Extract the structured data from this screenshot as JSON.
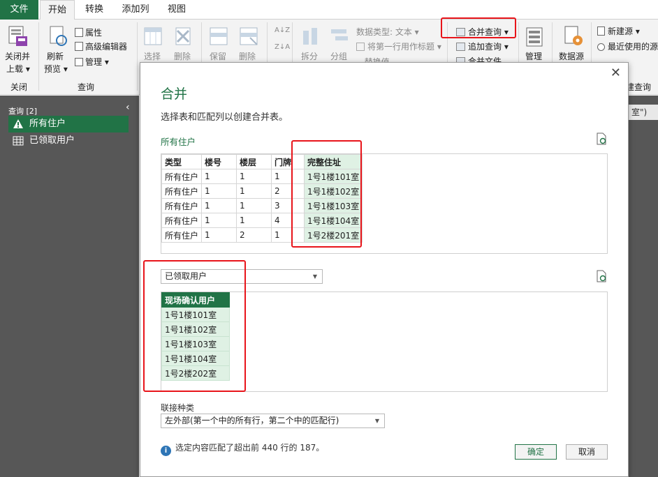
{
  "tabs": {
    "file": "文件",
    "home": "开始",
    "transform": "转换",
    "add_column": "添加列",
    "view": "视图"
  },
  "ribbon": {
    "close_load_line1": "关闭并",
    "close_load_line2": "上载",
    "refresh_line1": "刷新",
    "refresh_line2": "预览",
    "properties": "属性",
    "advanced_editor": "高级编辑器",
    "manage": "管理",
    "choose": "选择",
    "remove": "删除",
    "keep": "保留",
    "remove2": "删除",
    "split": "拆分",
    "group": "分组",
    "data_type": "数据类型: 文本",
    "use_first_row": "将第一行用作标题",
    "replace_values": "替换值",
    "merge_queries": "合并查询",
    "append_queries": "追加查询",
    "combine_files": "合并文件",
    "manage_params": "管理",
    "data_source": "数据源",
    "new_source": "新建源",
    "recent_sources": "最近使用的源",
    "group_close": "关闭",
    "group_query": "查询",
    "group_new_query": "建查询"
  },
  "left_pane": {
    "header": "查询 [2]",
    "items": [
      {
        "label": "所有住户"
      },
      {
        "label": "已领取用户"
      }
    ]
  },
  "bg_formula_fragment": "室\")",
  "dialog": {
    "title": "合并",
    "subtitle": "选择表和匹配列以创建合并表。",
    "table1_name": "所有住户",
    "table1": {
      "headers": [
        "类型",
        "楼号",
        "楼层",
        "门牌",
        "完整住址"
      ],
      "rows": [
        [
          "所有住户",
          "1",
          "1",
          "1",
          "1号1楼101室"
        ],
        [
          "所有住户",
          "1",
          "1",
          "2",
          "1号1楼102室"
        ],
        [
          "所有住户",
          "1",
          "1",
          "3",
          "1号1楼103室"
        ],
        [
          "所有住户",
          "1",
          "1",
          "4",
          "1号1楼104室"
        ],
        [
          "所有住户",
          "1",
          "2",
          "1",
          "1号2楼201室"
        ]
      ]
    },
    "table2_select": "已领取用户",
    "table2": {
      "header": "现场确认用户",
      "rows": [
        "1号1楼101室",
        "1号1楼102室",
        "1号1楼103室",
        "1号1楼104室",
        "1号2楼202室"
      ]
    },
    "join_label": "联接种类",
    "join_value": "左外部(第一个中的所有行，第二个中的匹配行)",
    "info_text": "选定内容匹配了超出前 440 行的 187。",
    "ok_label": "确定",
    "cancel_label": "取消"
  },
  "colors": {
    "accent": "#217346",
    "highlight": "#e8141a",
    "selected_cell": "#dff1e4"
  }
}
